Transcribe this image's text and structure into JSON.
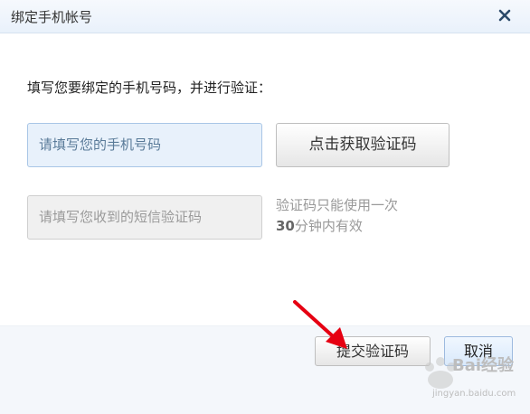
{
  "dialog": {
    "title": "绑定手机帐号",
    "close_icon": "close-icon"
  },
  "content": {
    "instruction": "填写您要绑定的手机号码，并进行验证：",
    "phone_placeholder": "请填写您的手机号码",
    "get_code_label": "点击获取验证码",
    "code_placeholder": "请填写您收到的短信验证码",
    "hint_line1": "验证码只能使用一次",
    "hint_line2_num": "30",
    "hint_line2_text": "分钟内有效"
  },
  "footer": {
    "submit_label": "提交验证码",
    "cancel_label": "取消"
  },
  "annotation": {
    "arrow_icon": "red-arrow-icon",
    "arrow_color": "#e60012"
  },
  "watermark": {
    "logo_text": "Bai经验",
    "url": "jingyan.baidu.com"
  }
}
